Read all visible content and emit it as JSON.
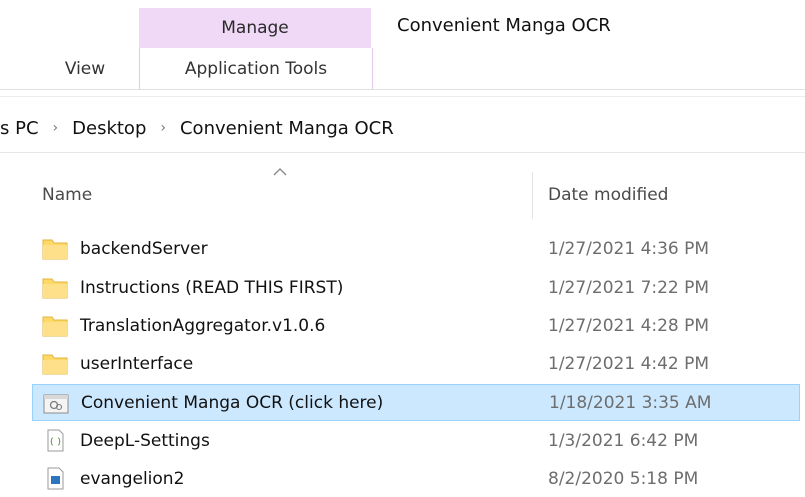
{
  "ribbon": {
    "manage_label": "Manage",
    "app_tools_label": "Application Tools",
    "view_label": "View",
    "window_title": "Convenient Manga OCR",
    "manage_color": "#f0d9f7"
  },
  "address": {
    "crumbs": [
      "s PC",
      "Desktop",
      "Convenient Manga OCR"
    ],
    "separator": "›"
  },
  "columns": {
    "name": "Name",
    "date": "Date modified",
    "sort": "ascending"
  },
  "files": [
    {
      "name": "backendServer",
      "date": "1/27/2021 4:36 PM",
      "icon": "folder-icon"
    },
    {
      "name": "Instructions (READ THIS FIRST)",
      "date": "1/27/2021 7:22 PM",
      "icon": "folder-icon"
    },
    {
      "name": "TranslationAggregator.v1.0.6",
      "date": "1/27/2021 4:28 PM",
      "icon": "folder-icon"
    },
    {
      "name": "userInterface",
      "date": "1/27/2021 4:42 PM",
      "icon": "folder-icon"
    },
    {
      "name": "Convenient Manga OCR (click here)",
      "date": "1/18/2021 3:35 AM",
      "icon": "batch-file-icon",
      "selected": true
    },
    {
      "name": "DeepL-Settings",
      "date": "1/3/2021 6:42 PM",
      "icon": "text-file-icon"
    },
    {
      "name": "evangelion2",
      "date": "8/2/2020 5:18 PM",
      "icon": "image-file-icon"
    }
  ],
  "colors": {
    "selection_bg": "#cce8ff",
    "selection_border": "#99d1ff",
    "folder": "#ffd966"
  }
}
